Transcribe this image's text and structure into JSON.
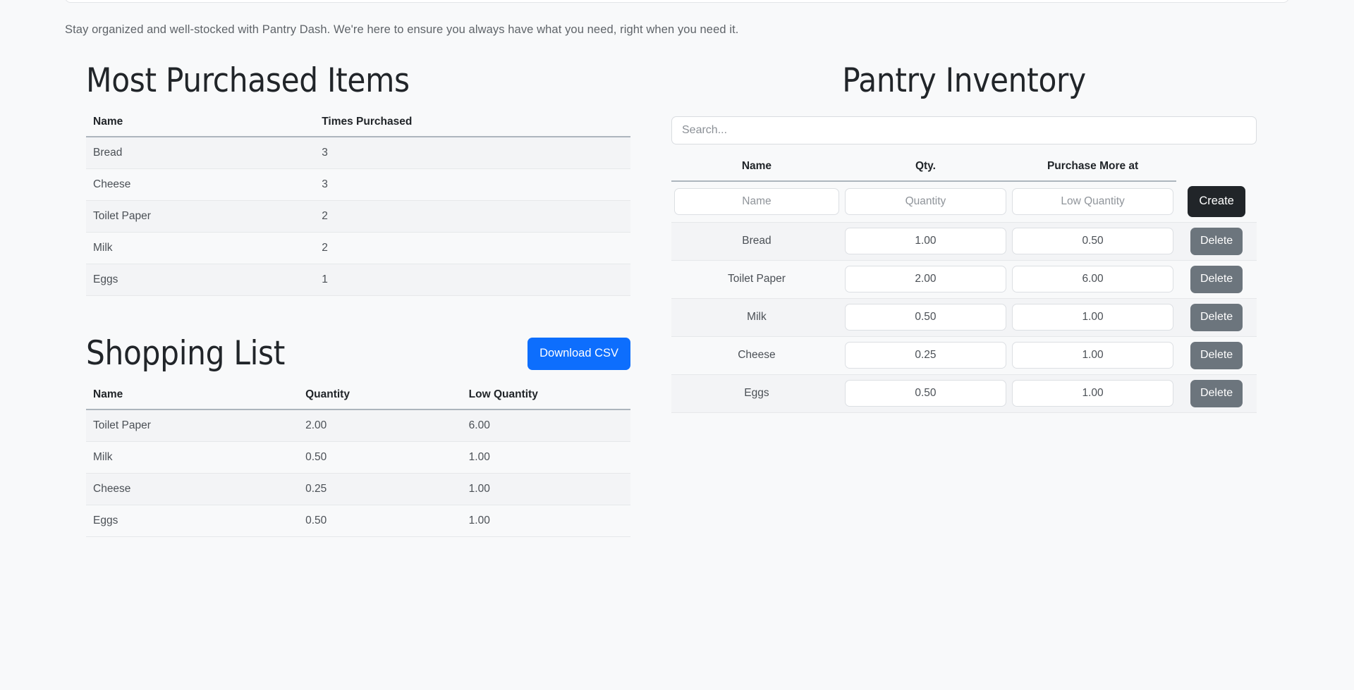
{
  "tagline": "Stay organized and well-stocked with Pantry Dash. We're here to ensure you always have what you need, right when you need it.",
  "most_purchased": {
    "title": "Most Purchased Items",
    "columns": [
      "Name",
      "Times Purchased"
    ],
    "rows": [
      {
        "name": "Bread",
        "times": "3"
      },
      {
        "name": "Cheese",
        "times": "3"
      },
      {
        "name": "Toilet Paper",
        "times": "2"
      },
      {
        "name": "Milk",
        "times": "2"
      },
      {
        "name": "Eggs",
        "times": "1"
      }
    ]
  },
  "shopping_list": {
    "title": "Shopping List",
    "download_label": "Download CSV",
    "columns": [
      "Name",
      "Quantity",
      "Low Quantity"
    ],
    "rows": [
      {
        "name": "Toilet Paper",
        "quantity": "2.00",
        "low_quantity": "6.00"
      },
      {
        "name": "Milk",
        "quantity": "0.50",
        "low_quantity": "1.00"
      },
      {
        "name": "Cheese",
        "quantity": "0.25",
        "low_quantity": "1.00"
      },
      {
        "name": "Eggs",
        "quantity": "0.50",
        "low_quantity": "1.00"
      }
    ]
  },
  "pantry_inventory": {
    "title": "Pantry Inventory",
    "search_placeholder": "Search...",
    "search_value": "",
    "columns": [
      "Name",
      "Qty.",
      "Purchase More at"
    ],
    "create_row": {
      "name_placeholder": "Name",
      "name_value": "",
      "quantity_placeholder": "Quantity",
      "quantity_value": "",
      "low_quantity_placeholder": "Low Quantity",
      "low_quantity_value": "",
      "create_label": "Create"
    },
    "delete_label": "Delete",
    "rows": [
      {
        "name": "Bread",
        "quantity": "1.00",
        "low_quantity": "0.50"
      },
      {
        "name": "Toilet Paper",
        "quantity": "2.00",
        "low_quantity": "6.00"
      },
      {
        "name": "Milk",
        "quantity": "0.50",
        "low_quantity": "1.00"
      },
      {
        "name": "Cheese",
        "quantity": "0.25",
        "low_quantity": "1.00"
      },
      {
        "name": "Eggs",
        "quantity": "0.50",
        "low_quantity": "1.00"
      }
    ]
  },
  "colors": {
    "page_background": "#f8f9fa",
    "primary_button": "#0d6efd",
    "dark_button": "#212529",
    "secondary_button": "#6c757d",
    "text": "#212529",
    "muted_text": "#5f6469"
  }
}
